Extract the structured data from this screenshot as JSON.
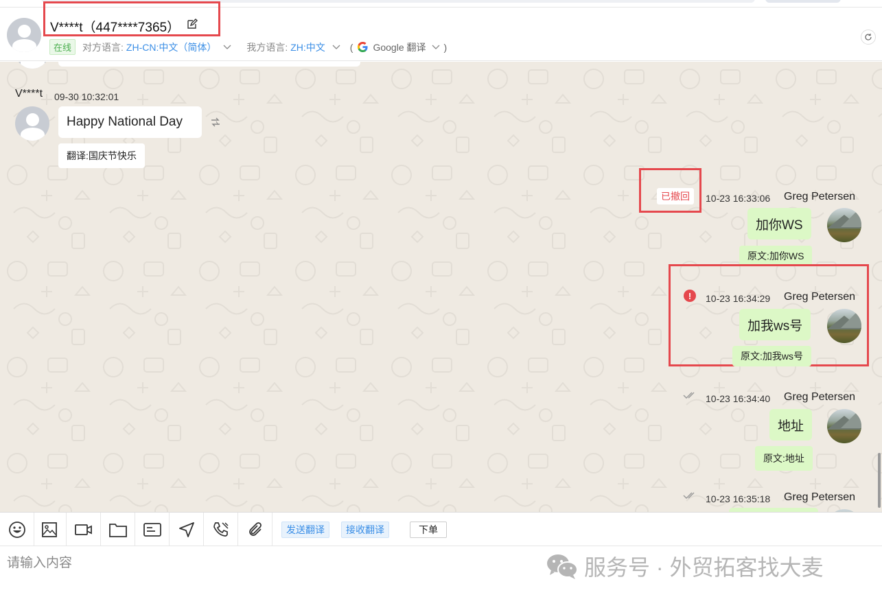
{
  "header": {
    "contact_name": "V****t（447****7365）",
    "status": "在线",
    "their_lang_label": "对方语言:",
    "their_lang_value": "ZH-CN:中文（简体）",
    "my_lang_label": "我方语言:",
    "my_lang_value": "ZH:中文",
    "translator_open": "(",
    "translator_name": "Google 翻译",
    "translator_close": ")"
  },
  "messages": {
    "incoming": {
      "sender": "V****t",
      "time": "09-30 10:32:01",
      "text": "Happy National Day",
      "translation": "翻译:国庆节快乐"
    },
    "outgoing": [
      {
        "sender": "Greg Petersen",
        "time": "10-23 16:33:06",
        "text": "加你WS",
        "original": "原文:加你WS",
        "status_label": "已撤回"
      },
      {
        "sender": "Greg Petersen",
        "time": "10-23 16:34:29",
        "text": "加我ws号",
        "original": "原文:加我ws号",
        "error_icon": "!"
      },
      {
        "sender": "Greg Petersen",
        "time": "10-23 16:34:40",
        "text": "地址",
        "original": "原文:地址"
      },
      {
        "sender": "Greg Petersen",
        "time": "10-23 16:35:18"
      }
    ]
  },
  "toolbar": {
    "send_translate": "发送翻译",
    "receive_translate": "接收翻译",
    "order": "下单",
    "icons": [
      "emoji-icon",
      "image-icon",
      "video-icon",
      "folder-icon",
      "card-icon",
      "location-icon",
      "call-icon",
      "attachment-icon"
    ]
  },
  "input": {
    "placeholder": "请输入内容"
  },
  "watermark": {
    "text": "服务号 · 外贸拓客找大麦"
  },
  "colors": {
    "accent": "#3a8ee6",
    "highlight_box": "#e5484d",
    "outgoing_bubble": "#dcf8c6",
    "chat_background": "#efeae2",
    "online": "#4caf50"
  }
}
